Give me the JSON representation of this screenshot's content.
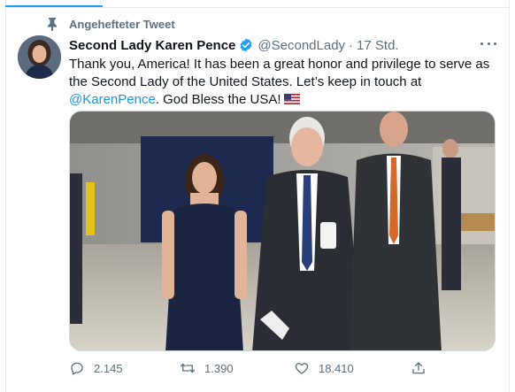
{
  "pinned": {
    "label": "Angehefteter Tweet",
    "icon": "pin-icon"
  },
  "tweet": {
    "author_name": "Second Lady Karen Pence",
    "handle": "@SecondLady",
    "separator": "·",
    "time": "17 Std.",
    "verified": true,
    "text_part1": "Thank you, America! It has been a great honor and privilege to serve as the Second Lady of the United States. Let’s keep in touch at ",
    "mention": "@KarenPence",
    "text_part2": ". God Bless the USA!",
    "emoji": "us-flag-icon"
  },
  "actions": {
    "reply_count": "2.145",
    "retweet_count": "1.390",
    "like_count": "18.410"
  },
  "colors": {
    "accent": "#1da1f2",
    "link": "#1b95e0",
    "muted": "#5b7083",
    "text": "#0f1419"
  }
}
